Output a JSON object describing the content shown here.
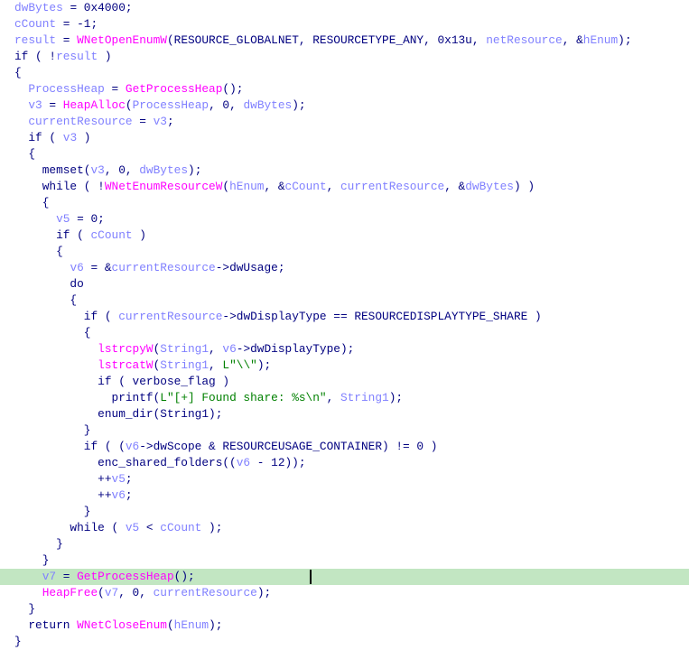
{
  "view": "pseudocode",
  "colors": {
    "default": "#000080",
    "variable": "#8080ff",
    "function": "#ff00ff",
    "string": "#008000",
    "highlight": "#c2e6c2"
  },
  "highlighted_line": 36,
  "lines": [
    {
      "tokens": [
        [
          "v",
          "dwBytes"
        ],
        [
          "t",
          " = 0x4000;"
        ]
      ]
    },
    {
      "tokens": [
        [
          "v",
          "cCount"
        ],
        [
          "t",
          " = -1;"
        ]
      ]
    },
    {
      "tokens": [
        [
          "v",
          "result"
        ],
        [
          "t",
          " = "
        ],
        [
          "f",
          "WNetOpenEnumW"
        ],
        [
          "t",
          "(RESOURCE_GLOBALNET, RESOURCETYPE_ANY, 0x13u, "
        ],
        [
          "v",
          "netResource"
        ],
        [
          "t",
          ", &"
        ],
        [
          "v",
          "hEnum"
        ],
        [
          "t",
          ");"
        ]
      ]
    },
    {
      "tokens": [
        [
          "t",
          "if ( !"
        ],
        [
          "v",
          "result"
        ],
        [
          "t",
          " )"
        ]
      ]
    },
    {
      "tokens": [
        [
          "t",
          "{"
        ]
      ]
    },
    {
      "tokens": [
        [
          "t",
          "  "
        ],
        [
          "v",
          "ProcessHeap"
        ],
        [
          "t",
          " = "
        ],
        [
          "f",
          "GetProcessHeap"
        ],
        [
          "t",
          "();"
        ]
      ]
    },
    {
      "tokens": [
        [
          "t",
          "  "
        ],
        [
          "v",
          "v3"
        ],
        [
          "t",
          " = "
        ],
        [
          "f",
          "HeapAlloc"
        ],
        [
          "t",
          "("
        ],
        [
          "v",
          "ProcessHeap"
        ],
        [
          "t",
          ", 0, "
        ],
        [
          "v",
          "dwBytes"
        ],
        [
          "t",
          ");"
        ]
      ]
    },
    {
      "tokens": [
        [
          "t",
          "  "
        ],
        [
          "v",
          "currentResource"
        ],
        [
          "t",
          " = "
        ],
        [
          "v",
          "v3"
        ],
        [
          "t",
          ";"
        ]
      ]
    },
    {
      "tokens": [
        [
          "t",
          "  if ( "
        ],
        [
          "v",
          "v3"
        ],
        [
          "t",
          " )"
        ]
      ]
    },
    {
      "tokens": [
        [
          "t",
          "  {"
        ]
      ]
    },
    {
      "tokens": [
        [
          "t",
          "    memset("
        ],
        [
          "v",
          "v3"
        ],
        [
          "t",
          ", 0, "
        ],
        [
          "v",
          "dwBytes"
        ],
        [
          "t",
          ");"
        ]
      ]
    },
    {
      "tokens": [
        [
          "t",
          "    while ( !"
        ],
        [
          "f",
          "WNetEnumResourceW"
        ],
        [
          "t",
          "("
        ],
        [
          "v",
          "hEnum"
        ],
        [
          "t",
          ", &"
        ],
        [
          "v",
          "cCount"
        ],
        [
          "t",
          ", "
        ],
        [
          "v",
          "currentResource"
        ],
        [
          "t",
          ", &"
        ],
        [
          "v",
          "dwBytes"
        ],
        [
          "t",
          ") )"
        ]
      ]
    },
    {
      "tokens": [
        [
          "t",
          "    {"
        ]
      ]
    },
    {
      "tokens": [
        [
          "t",
          "      "
        ],
        [
          "v",
          "v5"
        ],
        [
          "t",
          " = 0;"
        ]
      ]
    },
    {
      "tokens": [
        [
          "t",
          "      if ( "
        ],
        [
          "v",
          "cCount"
        ],
        [
          "t",
          " )"
        ]
      ]
    },
    {
      "tokens": [
        [
          "t",
          "      {"
        ]
      ]
    },
    {
      "tokens": [
        [
          "t",
          "        "
        ],
        [
          "v",
          "v6"
        ],
        [
          "t",
          " = &"
        ],
        [
          "v",
          "currentResource"
        ],
        [
          "t",
          "->dwUsage;"
        ]
      ]
    },
    {
      "tokens": [
        [
          "t",
          "        do"
        ]
      ]
    },
    {
      "tokens": [
        [
          "t",
          "        {"
        ]
      ]
    },
    {
      "tokens": [
        [
          "t",
          "          if ( "
        ],
        [
          "v",
          "currentResource"
        ],
        [
          "t",
          "->dwDisplayType == RESOURCEDISPLAYTYPE_SHARE )"
        ]
      ]
    },
    {
      "tokens": [
        [
          "t",
          "          {"
        ]
      ]
    },
    {
      "tokens": [
        [
          "t",
          "            "
        ],
        [
          "f",
          "lstrcpyW"
        ],
        [
          "t",
          "("
        ],
        [
          "v",
          "String1"
        ],
        [
          "t",
          ", "
        ],
        [
          "v",
          "v6"
        ],
        [
          "t",
          "->dwDisplayType);"
        ]
      ]
    },
    {
      "tokens": [
        [
          "t",
          "            "
        ],
        [
          "f",
          "lstrcatW"
        ],
        [
          "t",
          "("
        ],
        [
          "v",
          "String1"
        ],
        [
          "t",
          ", "
        ],
        [
          "s",
          "L\"\\\\\""
        ],
        [
          "t",
          ");"
        ]
      ]
    },
    {
      "tokens": [
        [
          "t",
          "            if ( verbose_flag )"
        ]
      ]
    },
    {
      "tokens": [
        [
          "t",
          "              printf("
        ],
        [
          "s",
          "L\"[+] Found share: %s\\n\""
        ],
        [
          "t",
          ", "
        ],
        [
          "v",
          "String1"
        ],
        [
          "t",
          ");"
        ]
      ]
    },
    {
      "tokens": [
        [
          "t",
          "            enum_dir(String1);"
        ]
      ]
    },
    {
      "tokens": [
        [
          "t",
          "          }"
        ]
      ]
    },
    {
      "tokens": [
        [
          "t",
          "          if ( ("
        ],
        [
          "v",
          "v6"
        ],
        [
          "t",
          "->dwScope & RESOURCEUSAGE_CONTAINER) != 0 )"
        ]
      ]
    },
    {
      "tokens": [
        [
          "t",
          "            enc_shared_folders(("
        ],
        [
          "v",
          "v6"
        ],
        [
          "t",
          " - 12));"
        ]
      ]
    },
    {
      "tokens": [
        [
          "t",
          "            ++"
        ],
        [
          "v",
          "v5"
        ],
        [
          "t",
          ";"
        ]
      ]
    },
    {
      "tokens": [
        [
          "t",
          "            ++"
        ],
        [
          "v",
          "v6"
        ],
        [
          "t",
          ";"
        ]
      ]
    },
    {
      "tokens": [
        [
          "t",
          "          }"
        ]
      ]
    },
    {
      "tokens": [
        [
          "t",
          "        while ( "
        ],
        [
          "v",
          "v5"
        ],
        [
          "t",
          " < "
        ],
        [
          "v",
          "cCount"
        ],
        [
          "t",
          " );"
        ]
      ]
    },
    {
      "tokens": [
        [
          "t",
          "      }"
        ]
      ]
    },
    {
      "tokens": [
        [
          "t",
          "    }"
        ]
      ]
    },
    {
      "tokens": [
        [
          "t",
          "    "
        ],
        [
          "v",
          "v7"
        ],
        [
          "t",
          " = "
        ],
        [
          "f",
          "GetProcessHeap"
        ],
        [
          "t",
          "();"
        ]
      ]
    },
    {
      "tokens": [
        [
          "t",
          "    "
        ],
        [
          "f",
          "HeapFree"
        ],
        [
          "t",
          "("
        ],
        [
          "v",
          "v7"
        ],
        [
          "t",
          ", 0, "
        ],
        [
          "v",
          "currentResource"
        ],
        [
          "t",
          ");"
        ]
      ]
    },
    {
      "tokens": [
        [
          "t",
          "  }"
        ]
      ]
    },
    {
      "tokens": [
        [
          "t",
          "  return "
        ],
        [
          "f",
          "WNetCloseEnum"
        ],
        [
          "t",
          "("
        ],
        [
          "v",
          "hEnum"
        ],
        [
          "t",
          ");"
        ]
      ]
    },
    {
      "tokens": [
        [
          "t",
          "}"
        ]
      ]
    }
  ]
}
